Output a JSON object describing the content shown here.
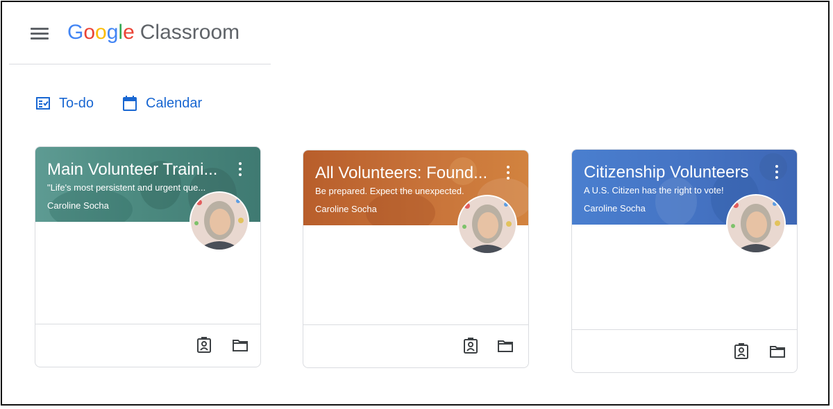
{
  "app": {
    "logo_letters": [
      "G",
      "o",
      "o",
      "g",
      "l",
      "e"
    ],
    "product": "Classroom"
  },
  "nav": {
    "todo_label": "To-do",
    "calendar_label": "Calendar"
  },
  "colors": {
    "accent": "#1967d2",
    "card_teal": "#4f8f86",
    "card_orange": "#c2692f",
    "card_blue": "#4574c4"
  },
  "cards": [
    {
      "title": "Main Volunteer Traini...",
      "subtitle": "\"Life's most persistent and urgent que...",
      "owner": "Caroline Socha"
    },
    {
      "title": "All Volunteers: Found...",
      "subtitle": "Be prepared. Expect the unexpected.",
      "owner": "Caroline Socha"
    },
    {
      "title": "Citizenship Volunteers",
      "subtitle": "A U.S. Citizen has the right to vote!",
      "owner": "Caroline Socha"
    }
  ],
  "icons": {
    "menu": "hamburger-menu-icon",
    "todo": "assignment-list-icon",
    "calendar": "calendar-icon",
    "more": "more-vert-icon",
    "gradebook": "portrait-badge-icon",
    "folder": "folder-icon"
  }
}
